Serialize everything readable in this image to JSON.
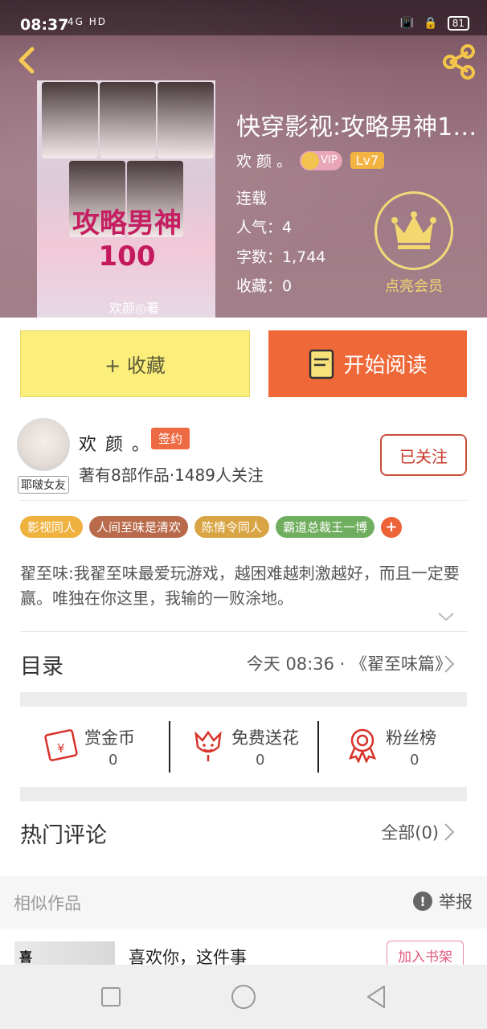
{
  "status_bar": {
    "time": "08:37",
    "network": "4G HD",
    "battery": "81"
  },
  "book": {
    "title": "快穿影视:攻略男神100...",
    "author": "欢 颜 。",
    "vip_label": "VIP",
    "level": "Lv7",
    "status": "连载",
    "popularity": "人气：4",
    "word_count": "字数：1,744",
    "favorites": "收藏：0",
    "cover_title": "攻略男神100",
    "cover_author": "欢颜◎著"
  },
  "member": {
    "label": "点亮会员"
  },
  "actions": {
    "collect_label": "+ 收藏",
    "read_label": "开始阅读"
  },
  "author_section": {
    "avatar_tag": "耶啵女友",
    "name": "欢 颜 。",
    "sign_badge": "签约",
    "stats": "著有8部作品·1489人关注",
    "follow_label": "已关注"
  },
  "tags": [
    {
      "label": "影视同人",
      "color": "#f0b23f"
    },
    {
      "label": "人间至味是清欢",
      "color": "#b86a4a"
    },
    {
      "label": "陈情令同人",
      "color": "#d9a443"
    },
    {
      "label": "霸道总裁王一博",
      "color": "#6fae5e"
    }
  ],
  "description": "翟至味:我翟至味最爱玩游戏，越困难越刺激越好，而且一定要赢。唯独在你这里，我输的一败涂地。",
  "toc": {
    "label": "目录",
    "info": "今天 08:36 · 《翟至味篇》"
  },
  "stats": [
    {
      "label": "赏金币",
      "value": "0",
      "icon": "reward-envelope-icon"
    },
    {
      "label": "免费送花",
      "value": "0",
      "icon": "flower-icon"
    },
    {
      "label": "粉丝榜",
      "value": "0",
      "icon": "badge-ribbon-icon"
    }
  ],
  "comments": {
    "label": "热门评论",
    "all": "全部(0)"
  },
  "similar": {
    "label": "相似作品",
    "report": "举报",
    "item_title": "喜欢你，这件事",
    "item_cover_text": "喜",
    "add_shelf": "加入书架"
  },
  "colors": {
    "accent": "#ee6838",
    "collect": "#fbee7b",
    "member_gold": "#f2d86e",
    "follow": "#c9382a"
  }
}
